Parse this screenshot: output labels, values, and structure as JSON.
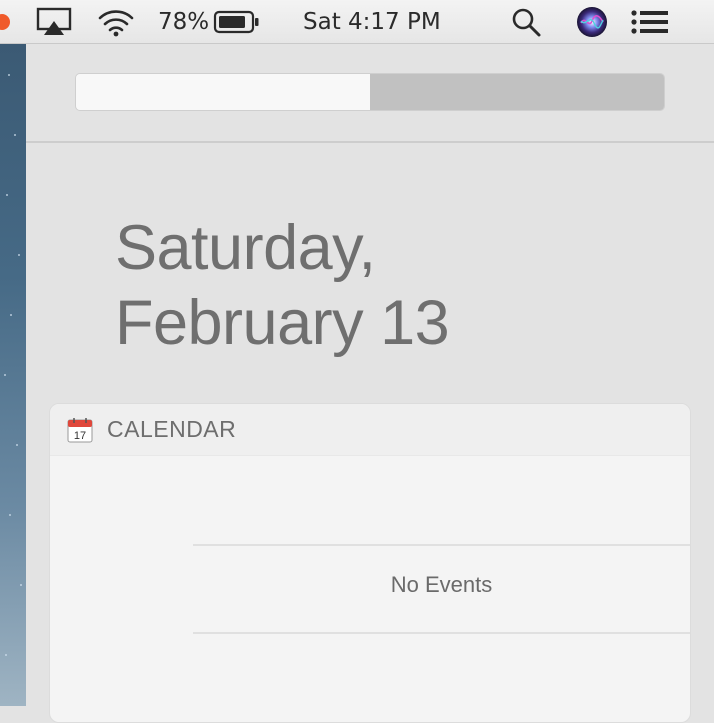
{
  "menubar": {
    "battery_percent": "78%",
    "clock": "Sat 4:17 PM",
    "icons": [
      "airplay-icon",
      "wifi-icon",
      "battery-icon",
      "spotlight-search-icon",
      "siri-icon",
      "notification-center-icon"
    ]
  },
  "panel": {
    "segmented": {
      "active": "left"
    },
    "date_line_1": "Saturday,",
    "date_line_2": "February 13",
    "widget": {
      "title": "CALENDAR",
      "icon_day": "17",
      "empty_text": "No Events"
    }
  },
  "colors": {
    "menubar_bg": "#ececec",
    "panel_bg": "#e3e3e3",
    "widget_bg": "#f4f4f4",
    "text_gray": "#6f6f6f"
  }
}
